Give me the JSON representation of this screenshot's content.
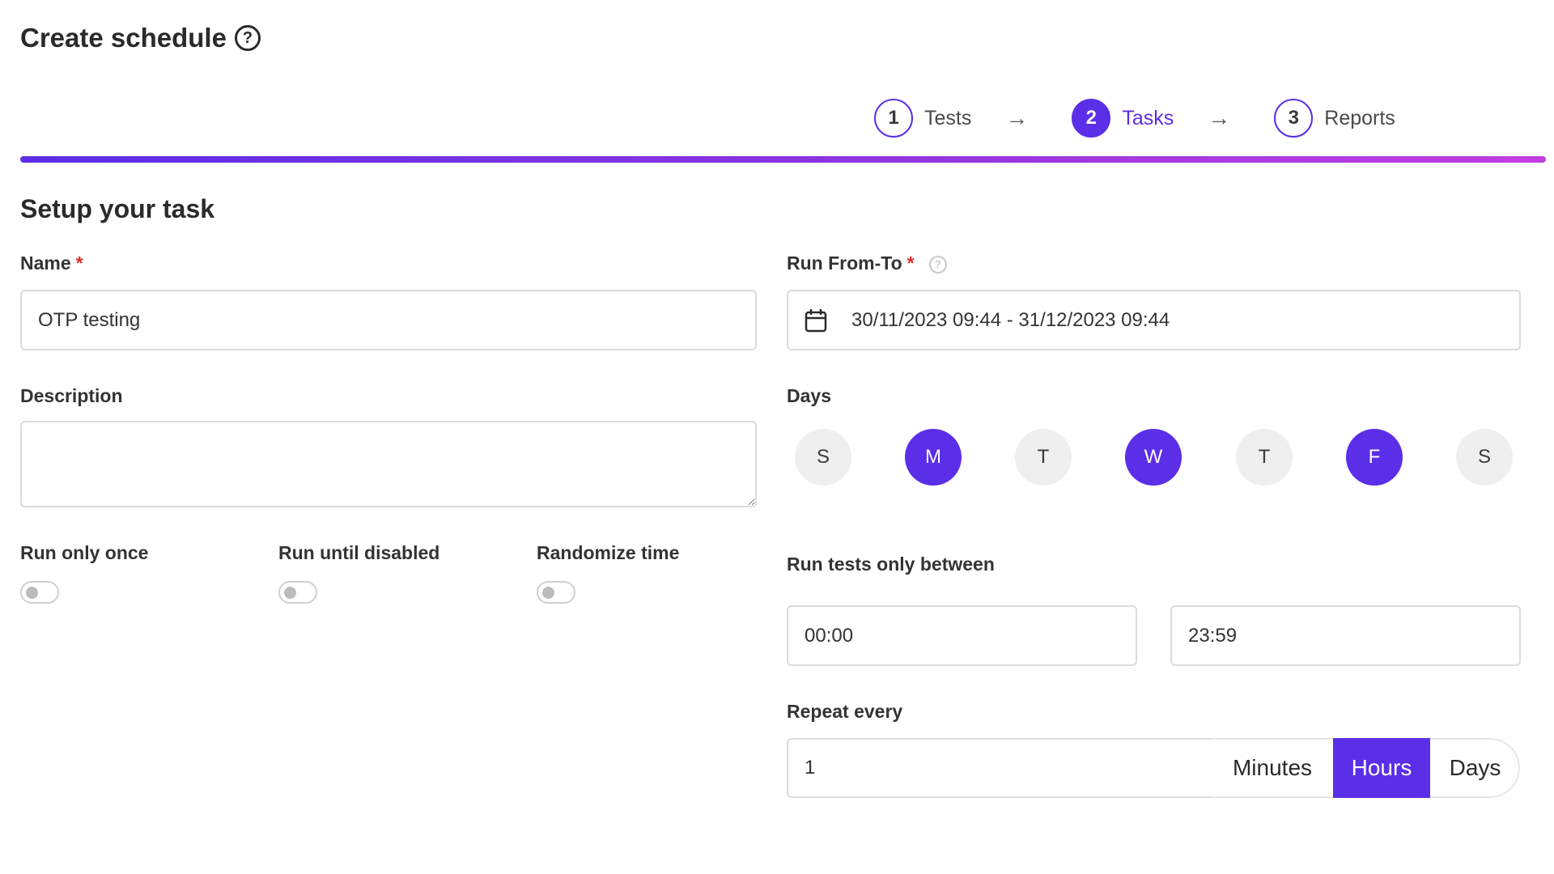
{
  "header": {
    "title": "Create schedule",
    "help_icon": "?"
  },
  "stepper": {
    "steps": [
      {
        "number": "1",
        "label": "Tests",
        "active": false
      },
      {
        "number": "2",
        "label": "Tasks",
        "active": true
      },
      {
        "number": "3",
        "label": "Reports",
        "active": false
      }
    ],
    "arrow": "→"
  },
  "section": {
    "title": "Setup your task"
  },
  "form": {
    "name": {
      "label": "Name",
      "required_mark": "*",
      "value": "OTP testing"
    },
    "description": {
      "label": "Description",
      "value": ""
    },
    "toggles": [
      {
        "label": "Run only once",
        "checked": false
      },
      {
        "label": "Run until disabled",
        "checked": false
      },
      {
        "label": "Randomize time",
        "checked": false
      }
    ],
    "run_from_to": {
      "label": "Run From-To",
      "required_mark": "*",
      "help_icon": "?",
      "value": "30/11/2023 09:44 - 31/12/2023 09:44"
    },
    "days": {
      "label": "Days",
      "items": [
        {
          "letter": "S",
          "selected": false
        },
        {
          "letter": "M",
          "selected": true
        },
        {
          "letter": "T",
          "selected": false
        },
        {
          "letter": "W",
          "selected": true
        },
        {
          "letter": "T",
          "selected": false
        },
        {
          "letter": "F",
          "selected": true
        },
        {
          "letter": "S",
          "selected": false
        }
      ]
    },
    "run_between": {
      "label": "Run tests only between",
      "start": "00:00",
      "end": "23:59"
    },
    "repeat": {
      "label": "Repeat every",
      "value": "1",
      "units": [
        "Minutes",
        "Hours",
        "Days"
      ],
      "selected_unit": "Hours"
    }
  },
  "colors": {
    "accent": "#5b2ee8",
    "required": "#e02d2d",
    "gradient_end": "#c23ee0"
  }
}
